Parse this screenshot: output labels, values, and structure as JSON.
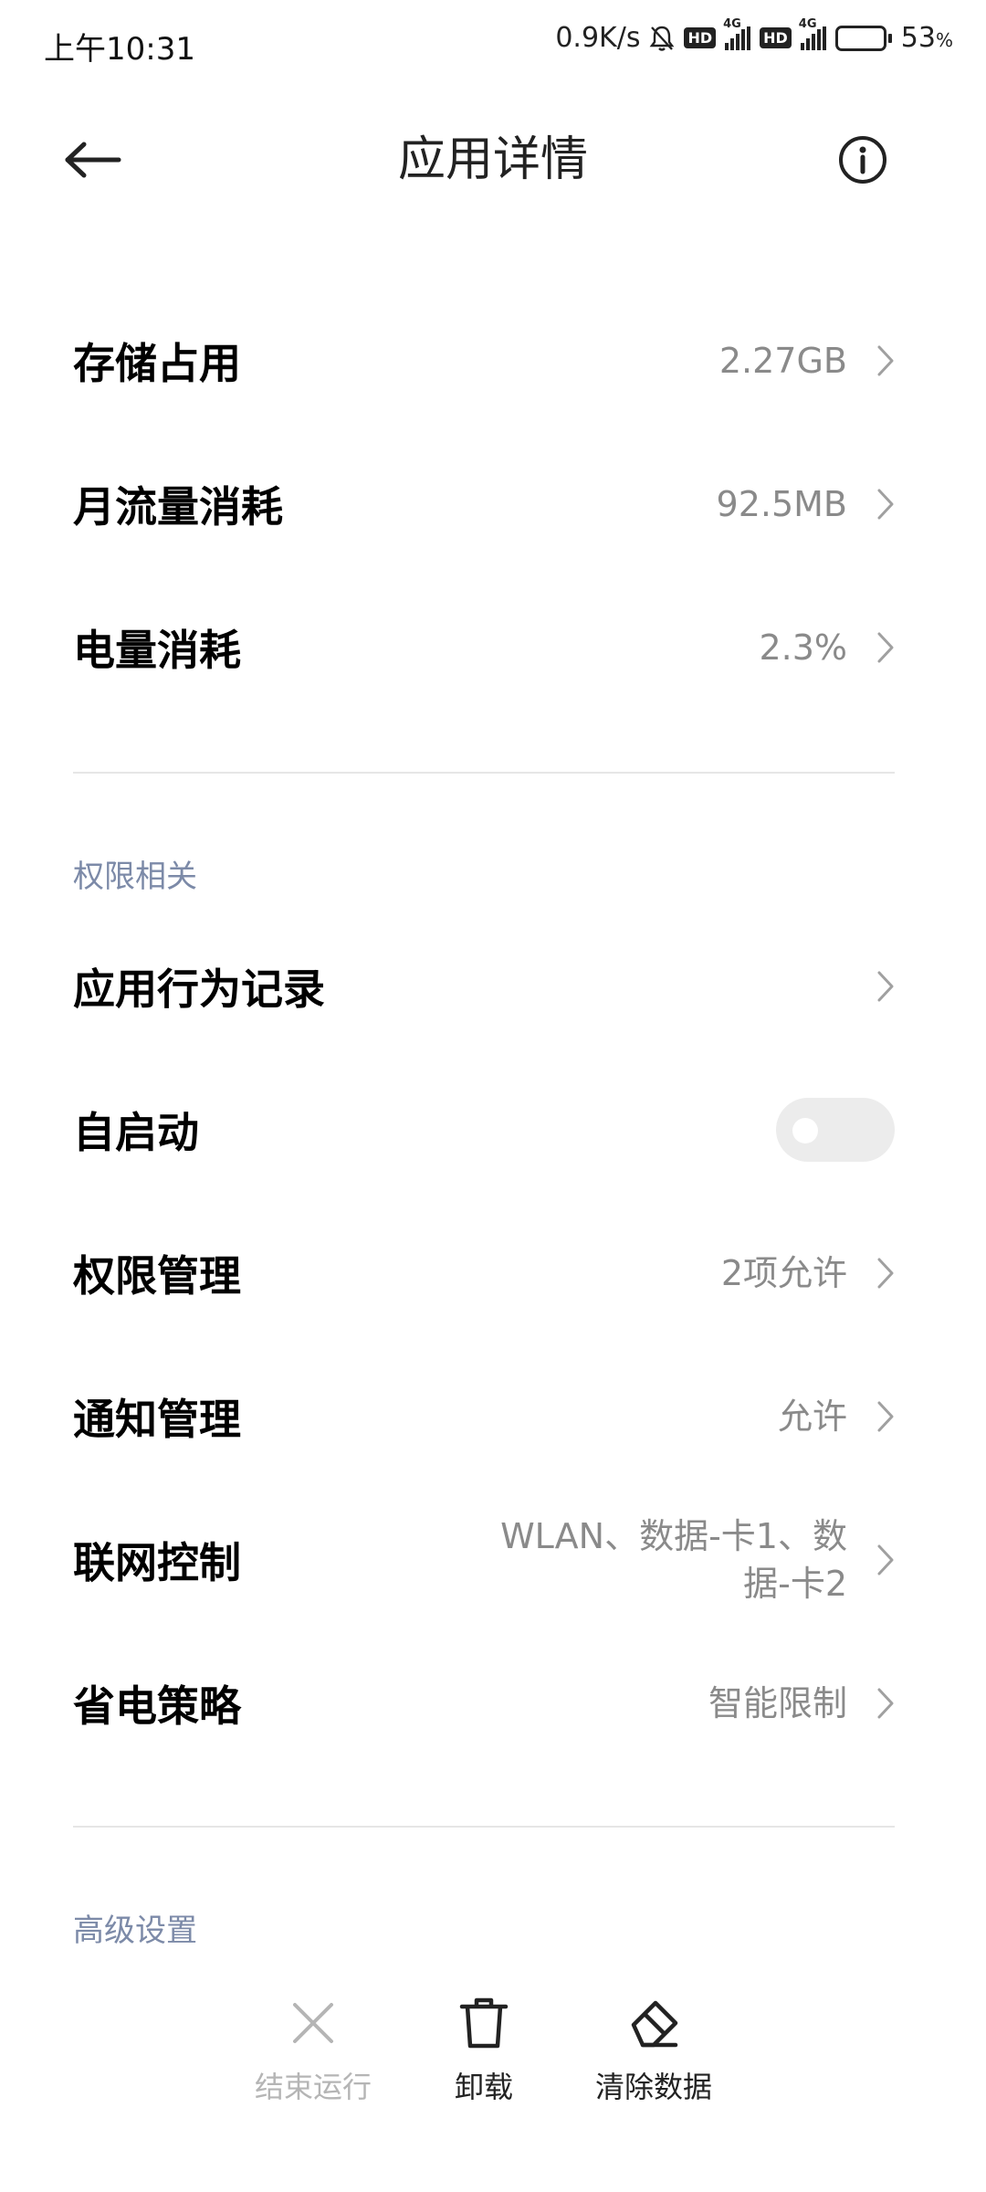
{
  "status_bar": {
    "time": "上午10:31",
    "network_speed": "0.9K/s",
    "hd1": "HD",
    "sig1_tag": "4G",
    "hd2": "HD",
    "sig2_tag": "4G",
    "battery_percent": "53",
    "battery_unit": "%",
    "battery_level": 0.53
  },
  "header": {
    "title": "应用详情"
  },
  "rows": {
    "storage": {
      "label": "存储占用",
      "value": "2.27GB"
    },
    "monthly_data": {
      "label": "月流量消耗",
      "value": "92.5MB"
    },
    "battery_usage": {
      "label": "电量消耗",
      "value": "2.3%"
    }
  },
  "permissions_section": {
    "title": "权限相关",
    "behavior_record": {
      "label": "应用行为记录"
    },
    "autostart": {
      "label": "自启动",
      "enabled": false
    },
    "permission_mgmt": {
      "label": "权限管理",
      "value": "2项允许"
    },
    "notification_mgmt": {
      "label": "通知管理",
      "value": "允许"
    },
    "network_control": {
      "label": "联网控制",
      "value_line1": "WLAN、数据-卡1、数",
      "value_line2": "据-卡2"
    },
    "power_saving": {
      "label": "省电策略",
      "value": "智能限制"
    }
  },
  "advanced_section": {
    "title": "高级设置"
  },
  "bottom_actions": {
    "force_stop": "结束运行",
    "uninstall": "卸载",
    "clear_data": "清除数据"
  },
  "colors": {
    "section_title": "#7c8aa8",
    "value_text": "#8a8a8a",
    "battery_fill": "#f3b23e"
  }
}
